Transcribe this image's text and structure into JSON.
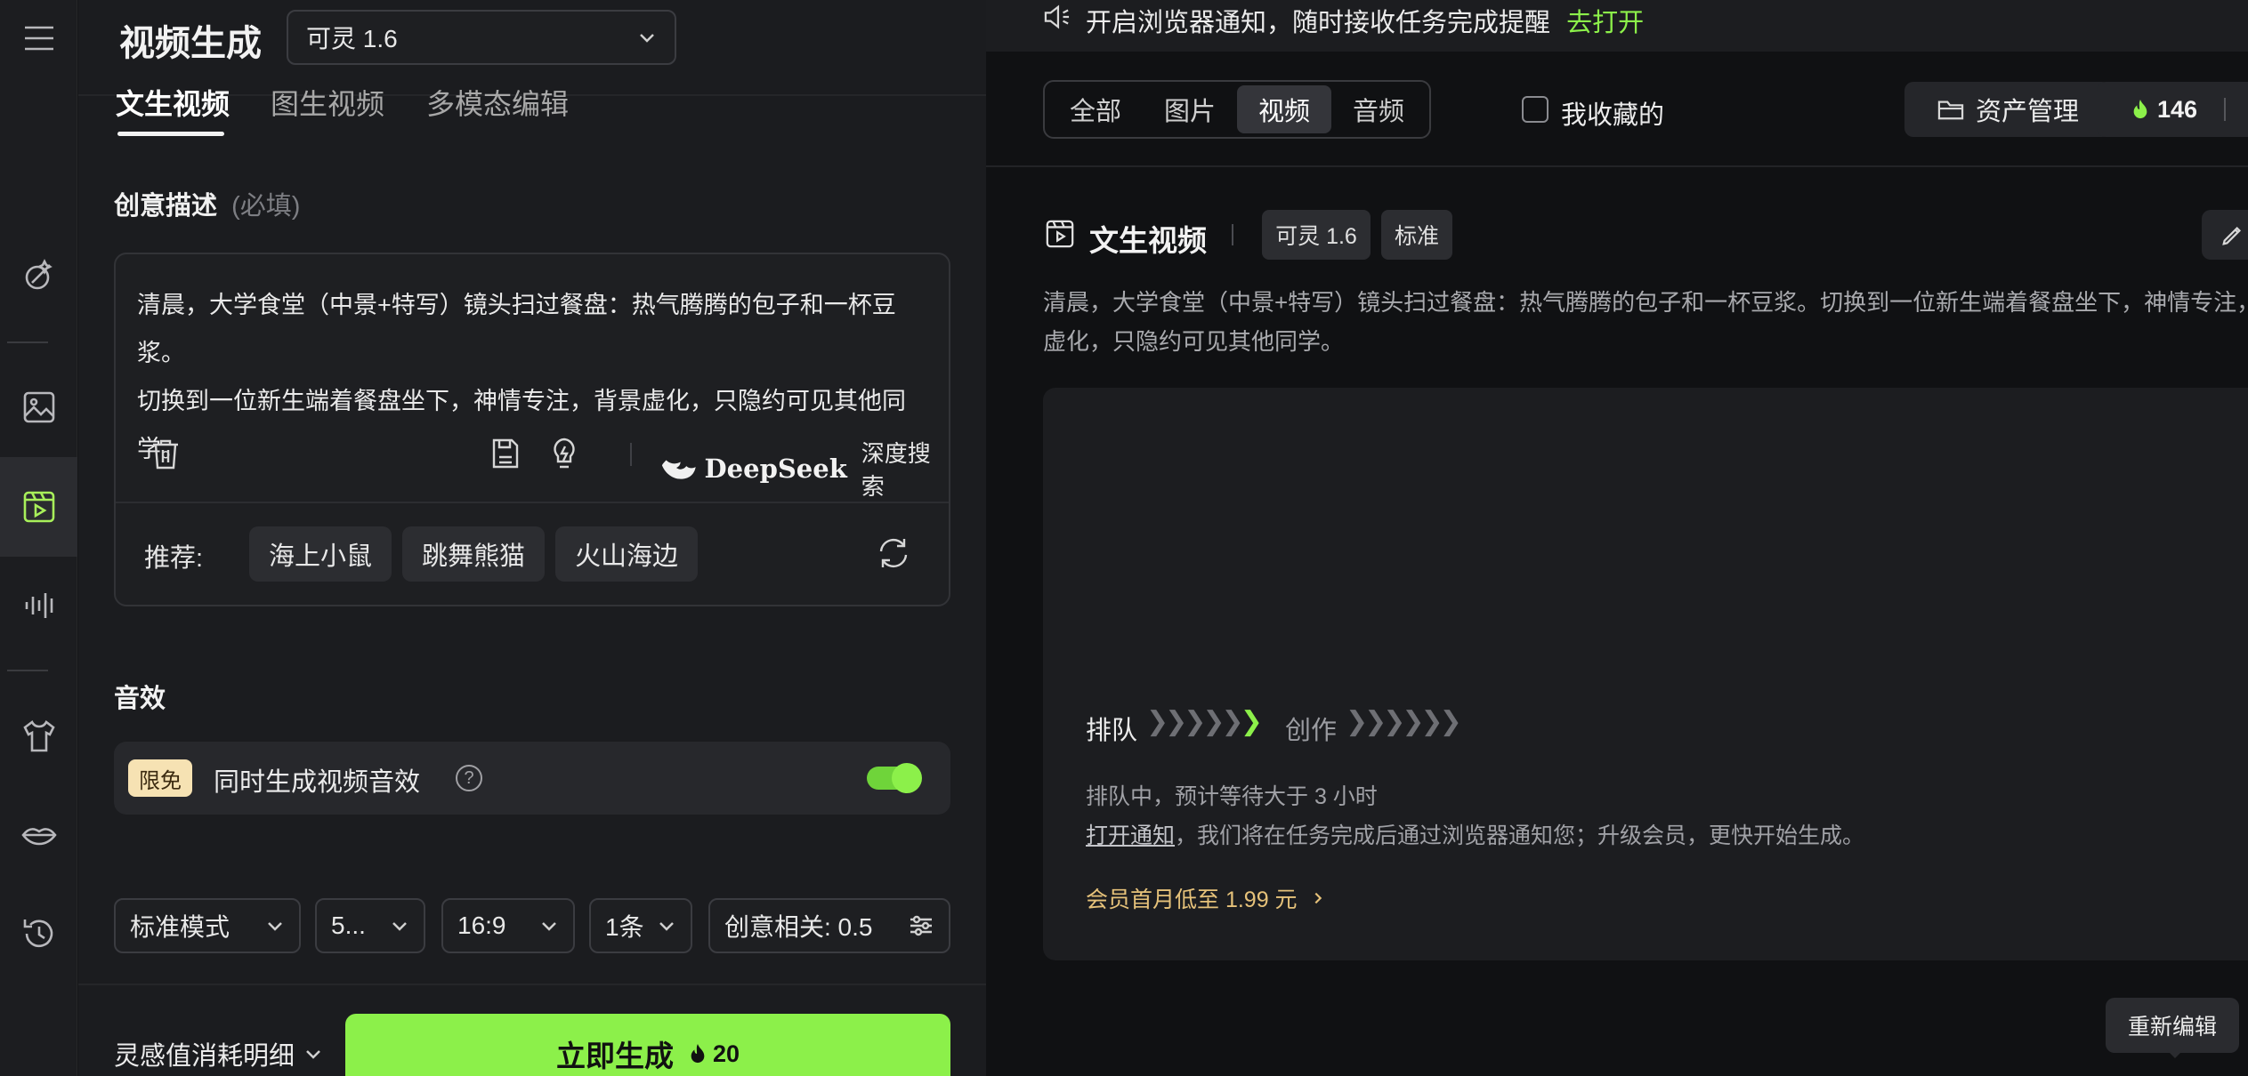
{
  "header": {
    "title": "视频生成",
    "model": "可灵 1.6"
  },
  "tabs": [
    "文生视频",
    "图生视频",
    "多模态编辑"
  ],
  "prompt": {
    "label": "创意描述",
    "required": "(必填)",
    "text_line1": "清晨，大学食堂（中景+特写）镜头扫过餐盘：热气腾腾的包子和一杯豆浆。",
    "text_line2": "切换到一位新生端着餐盘坐下，神情专注，背景虚化，只隐约可见其他同学。",
    "deepseek_brand": "DeepSeek",
    "deepseek_action": "深度搜索",
    "recommend_label": "推荐:",
    "recommend": [
      "海上小鼠",
      "跳舞熊猫",
      "火山海边"
    ]
  },
  "sound": {
    "title": "音效",
    "badge": "限免",
    "label": "同时生成视频音效",
    "enabled": true
  },
  "params": {
    "mode": "标准模式",
    "duration": "5...",
    "ratio": "16:9",
    "count": "1条",
    "relevance": "创意相关: 0.5"
  },
  "footer": {
    "cost_detail": "灵感值消耗明细",
    "generate": "立即生成",
    "cost": "20"
  },
  "notice": {
    "text": "开启浏览器通知，随时接收任务完成提醒",
    "link": "去打开"
  },
  "filters": {
    "tabs": [
      "全部",
      "图片",
      "视频",
      "音频"
    ],
    "active": "视频",
    "favorites": "我收藏的",
    "assets": "资产管理",
    "credits": "146"
  },
  "task": {
    "title": "文生视频",
    "model_tag": "可灵 1.6",
    "quality_tag": "标准",
    "desc_line1": "清晨，大学食堂（中景+特写）镜头扫过餐盘：热气腾腾的包子和一杯豆浆。切换到一位新生端着餐盘坐下，神情专注，",
    "desc_line2": "虚化，只隐约可见其他同学。",
    "step_queue": "排队",
    "step_create": "创作",
    "status": "排队中，预计等待大于 3 小时",
    "notify_link": "打开通知",
    "notify_rest": "，我们将在任务完成后通过浏览器通知您；升级会员，更快开始生成。",
    "promo": "会员首月低至 1.99 元",
    "tooltip": "重新编辑"
  },
  "colors": {
    "accent": "#8cf04a",
    "active_icon": "#a8f05a",
    "promo": "#e6c27a",
    "badge_bg": "#f6e2b3"
  }
}
